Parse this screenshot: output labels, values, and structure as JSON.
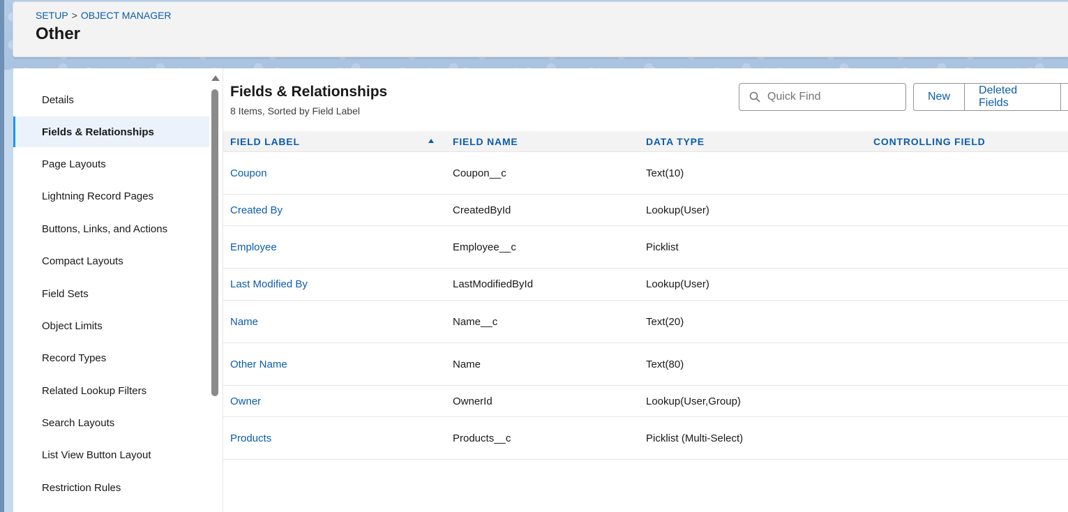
{
  "breadcrumb": {
    "setup": "SETUP",
    "separator": ">",
    "object_manager": "OBJECT MANAGER"
  },
  "page_title": "Other",
  "sidebar": {
    "items": [
      {
        "label": "Details"
      },
      {
        "label": "Fields & Relationships",
        "active": true
      },
      {
        "label": "Page Layouts"
      },
      {
        "label": "Lightning Record Pages"
      },
      {
        "label": "Buttons, Links, and Actions"
      },
      {
        "label": "Compact Layouts"
      },
      {
        "label": "Field Sets"
      },
      {
        "label": "Object Limits"
      },
      {
        "label": "Record Types"
      },
      {
        "label": "Related Lookup Filters"
      },
      {
        "label": "Search Layouts"
      },
      {
        "label": "List View Button Layout"
      },
      {
        "label": "Restriction Rules"
      }
    ]
  },
  "main": {
    "title": "Fields & Relationships",
    "subtitle": "8 Items, Sorted by Field Label",
    "quick_find_placeholder": "Quick Find",
    "new_button": "New",
    "deleted_fields_button": "Deleted Fields"
  },
  "table": {
    "columns": [
      "FIELD LABEL",
      "FIELD NAME",
      "DATA TYPE",
      "CONTROLLING FIELD"
    ],
    "rows": [
      {
        "label": "Coupon",
        "name": "Coupon__c",
        "type": "Text(10)",
        "controlling": ""
      },
      {
        "label": "Created By",
        "name": "CreatedById",
        "type": "Lookup(User)",
        "controlling": ""
      },
      {
        "label": "Employee",
        "name": "Employee__c",
        "type": "Picklist",
        "controlling": ""
      },
      {
        "label": "Last Modified By",
        "name": "LastModifiedById",
        "type": "Lookup(User)",
        "controlling": ""
      },
      {
        "label": "Name",
        "name": "Name__c",
        "type": "Text(20)",
        "controlling": ""
      },
      {
        "label": "Other Name",
        "name": "Name",
        "type": "Text(80)",
        "controlling": ""
      },
      {
        "label": "Owner",
        "name": "OwnerId",
        "type": "Lookup(User,Group)",
        "controlling": ""
      },
      {
        "label": "Products",
        "name": "Products__c",
        "type": "Picklist (Multi-Select)",
        "controlling": ""
      }
    ]
  },
  "colors": {
    "link": "#0b5cab",
    "active_nav_bg": "#ebf2fc",
    "active_nav_border": "#1b96ff"
  },
  "icons": {
    "quick_find": "search-icon",
    "sort": "sort-ascending-icon"
  }
}
